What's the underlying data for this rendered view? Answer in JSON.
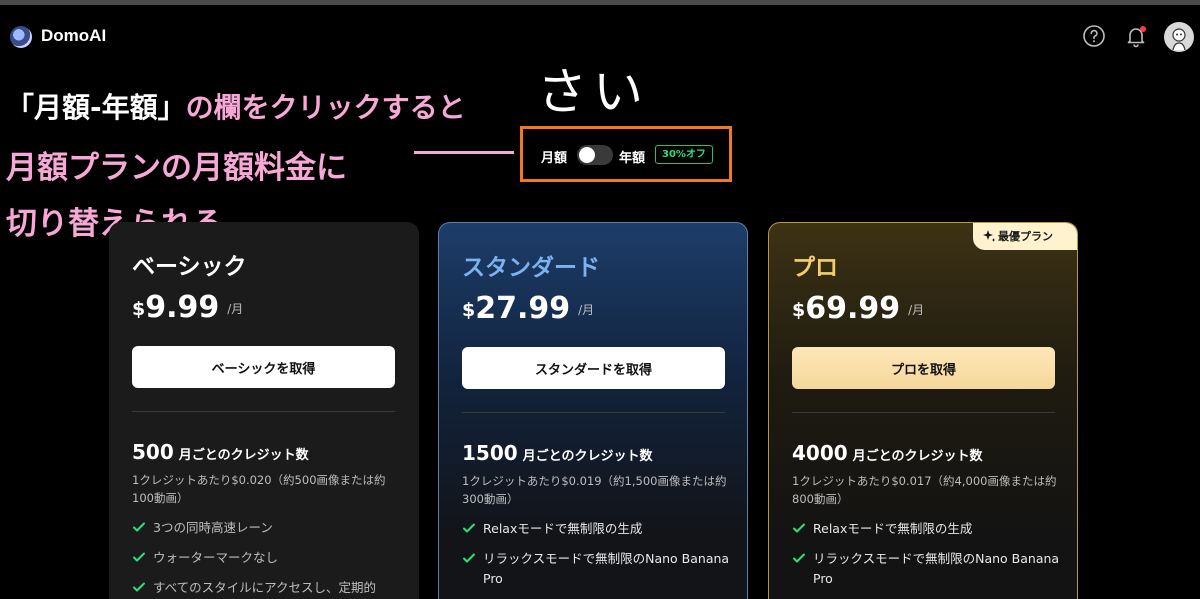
{
  "header": {
    "brand": "DomoAI"
  },
  "annotation": {
    "line1_quote": "「月額-年額」",
    "line1_rest": "の欄をクリックすると",
    "line1_tail": "さい",
    "line2": "月額プランの月額料金に",
    "line3": "切り替えられる"
  },
  "billing": {
    "monthly_label": "月額",
    "yearly_label": "年額",
    "discount_badge": "30%オフ",
    "selected": "monthly"
  },
  "plans": [
    {
      "name": "ベーシック",
      "currency": "$",
      "price": "9.99",
      "period": "/月",
      "cta": "ベーシックを取得",
      "credits": "500",
      "credits_unit": "月ごとのクレジット数",
      "rate": "1クレジットあたり$0.020（約500画像または約100動画）",
      "features": [
        "3つの同時高速レーン",
        "ウォーターマークなし",
        "すべてのスタイルにアクセスし、定期的"
      ]
    },
    {
      "name": "スタンダード",
      "currency": "$",
      "price": "27.99",
      "period": "/月",
      "cta": "スタンダードを取得",
      "credits": "1500",
      "credits_unit": "月ごとのクレジット数",
      "rate": "1クレジットあたり$0.019（約1,500画像または約300動画）",
      "features": [
        "Relaxモードで無制限の生成",
        "リラックスモードで無制限のNano Banana Pro"
      ]
    },
    {
      "name": "プロ",
      "badge": "最優プラン",
      "currency": "$",
      "price": "69.99",
      "period": "/月",
      "cta": "プロを取得",
      "credits": "4000",
      "credits_unit": "月ごとのクレジット数",
      "rate": "1クレジットあたり$0.017（約4,000画像または約800動画）",
      "features": [
        "Relaxモードで無制限の生成",
        "リラックスモードで無制限のNano Banana Pro"
      ]
    }
  ],
  "colors": {
    "annotation_pink": "#f7a8d6",
    "highlight_box": "#f07a22",
    "discount_green": "#2ee07a",
    "check_green": "#2ee07a",
    "standard_accent": "#7cb2f0",
    "pro_accent": "#f4ce6a"
  },
  "icons": [
    "domoai-logo-icon",
    "help-icon",
    "bell-icon",
    "avatar",
    "sparkle-icon",
    "check-icon"
  ]
}
